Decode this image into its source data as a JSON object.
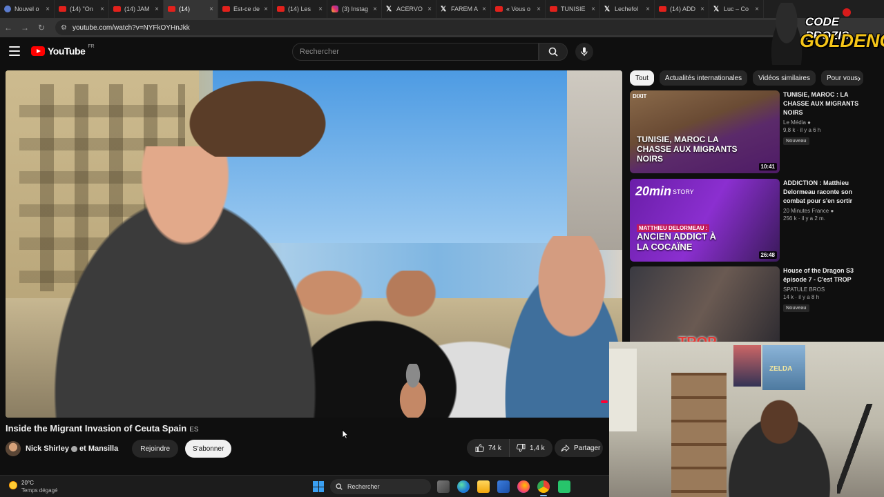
{
  "browser": {
    "tabs": [
      {
        "title": "Nouvel o",
        "icon": "generic"
      },
      {
        "title": "(14) \"On",
        "icon": "yt"
      },
      {
        "title": "(14) JAM",
        "icon": "yt"
      },
      {
        "title": "(14)",
        "icon": "yt",
        "active": true
      },
      {
        "title": "Est-ce de",
        "icon": "yt"
      },
      {
        "title": "(14) Les",
        "icon": "yt"
      },
      {
        "title": "(3) Instag",
        "icon": "ig"
      },
      {
        "title": "ACERVO",
        "icon": "x"
      },
      {
        "title": "FAREM A",
        "icon": "x"
      },
      {
        "title": "« Vous o",
        "icon": "yt"
      },
      {
        "title": "TUNISIE",
        "icon": "yt"
      },
      {
        "title": "Lechefol",
        "icon": "x"
      },
      {
        "title": "(14) ADD",
        "icon": "yt"
      },
      {
        "title": "Luc – Co",
        "icon": "x"
      }
    ],
    "url": "youtube.com/watch?v=NYFkOYHnJkk"
  },
  "youtube": {
    "logo_text": "YouTube",
    "logo_region": "FR",
    "search_placeholder": "Rechercher"
  },
  "video": {
    "title": "Inside the Migrant Invasion of Ceuta Spain",
    "title_tag": "ES",
    "channel": "Nick Shirley",
    "channel_extra": "et Mansilla",
    "join_label": "Rejoindre",
    "subscribe_label": "S'abonner",
    "likes": "74 k",
    "dislikes": "1,4 k",
    "share_label": "Partager"
  },
  "sidebar": {
    "chips": [
      "Tout",
      "Actualités internationales",
      "Vidéos similaires",
      "Pour vous"
    ],
    "recommendations": [
      {
        "title": "TUNISIE, MAROC : LA CHASSE AUX MIGRANTS NOIRS",
        "channel": "Le Média",
        "meta": "9,8 k · il y a 6 h",
        "badge": "Nouveau",
        "duration": "10:41",
        "thumb_brand": "DIXIT",
        "thumb_text": "TUNISIE, MAROC LA CHASSE AUX MIGRANTS NOIRS"
      },
      {
        "title": "ADDICTION : Matthieu Delormeau raconte son combat pour s'en sortir",
        "channel": "20 Minutes France",
        "meta": "256 k · il y a 2 m.",
        "badge": "",
        "duration": "26:48",
        "thumb_brand": "20min",
        "thumb_tag": "STORY",
        "thumb_subtitle": "MATTHIEU DELORMEAU :",
        "thumb_text": "ANCIEN ADDICT À LA COCAÏNE"
      },
      {
        "title": "House of the Dragon S3 épisode 7 - C'est TROP",
        "channel": "SPATULE BROS",
        "meta": "14 k · il y a 8 h",
        "badge": "Nouveau",
        "duration": "",
        "thumb_text": "TROP"
      }
    ]
  },
  "promo": {
    "line1": "CODE PROZIS",
    "line2": "GOLDENG"
  },
  "webcam": {
    "poster_text": "ZELDA"
  },
  "taskbar": {
    "temperature": "20°C",
    "weather": "Temps dégagé",
    "search_label": "Rechercher"
  }
}
